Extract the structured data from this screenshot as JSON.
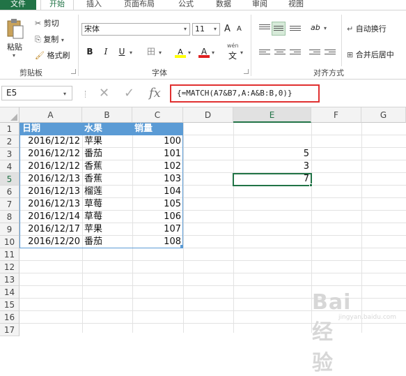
{
  "tabs": [
    "文件",
    "开始",
    "插入",
    "页面布局",
    "公式",
    "数据",
    "审阅",
    "视图"
  ],
  "active_tab": "开始",
  "ribbon": {
    "clipboard": {
      "paste": "粘贴",
      "cut": "剪切",
      "copy": "复制",
      "format_painter": "格式刷",
      "label": "剪贴板"
    },
    "font": {
      "name": "宋体",
      "size": "11",
      "grow": "A",
      "shrink": "A",
      "bold": "B",
      "italic": "I",
      "underline": "U",
      "border": "田",
      "fill": "A",
      "color": "A",
      "wen": "wén",
      "wen_char": "文",
      "label": "字体"
    },
    "alignment": {
      "wrap": "自动换行",
      "merge": "合并后居中",
      "label": "对齐方式",
      "orient": "ab"
    }
  },
  "formula_bar": {
    "name_box": "E5",
    "cancel": "✕",
    "enter": "✓",
    "fx": "fx",
    "formula": "{=MATCH(A7&B7,A:A&B:B,0)}"
  },
  "columns": [
    "A",
    "B",
    "C",
    "D",
    "E",
    "F",
    "G"
  ],
  "selected_column": "E",
  "selected_row": "5",
  "rows": [
    "1",
    "2",
    "3",
    "4",
    "5",
    "6",
    "7",
    "8",
    "9",
    "10",
    "11",
    "12",
    "13",
    "14",
    "15",
    "16",
    "17"
  ],
  "table": {
    "headers": [
      "日期",
      "水果",
      "销量"
    ],
    "data": [
      [
        "2016/12/12",
        "苹果",
        "100"
      ],
      [
        "2016/12/12",
        "番茄",
        "101"
      ],
      [
        "2016/12/12",
        "香蕉",
        "102"
      ],
      [
        "2016/12/13",
        "香蕉",
        "103"
      ],
      [
        "2016/12/13",
        "榴莲",
        "104"
      ],
      [
        "2016/12/13",
        "草莓",
        "105"
      ],
      [
        "2016/12/14",
        "草莓",
        "106"
      ],
      [
        "2016/12/17",
        "苹果",
        "107"
      ],
      [
        "2016/12/20",
        "番茄",
        "108"
      ]
    ]
  },
  "e_column": {
    "E3": "5",
    "E4": "3",
    "E5": "7"
  },
  "watermark": {
    "main": "Bai 经验",
    "sub": "jingyan.baidu.com"
  },
  "colors": {
    "excel_green": "#217346",
    "table_header": "#5b9bd5",
    "formula_highlight": "#e03030"
  }
}
